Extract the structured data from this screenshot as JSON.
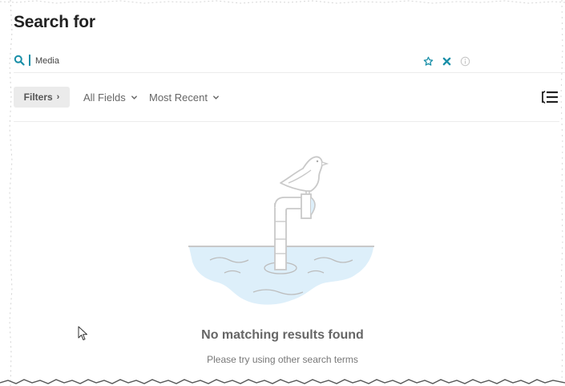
{
  "page": {
    "title": "Search for"
  },
  "search": {
    "value": "Media",
    "icons": [
      "search-icon",
      "star-icon",
      "close-icon",
      "info-icon"
    ]
  },
  "toolbar": {
    "filters_label": "Filters",
    "fields_label": "All Fields",
    "sort_label": "Most Recent",
    "view_toggle_icon": "list-view-icon"
  },
  "empty_state": {
    "title": "No matching results found",
    "subtitle": "Please try using other search terms",
    "illustration_icon": "seagull-periscope-illustration"
  },
  "colors": {
    "accent": "#1a8fa8",
    "water": "#ddeffa",
    "illustration_stroke": "#c9c9c9"
  }
}
